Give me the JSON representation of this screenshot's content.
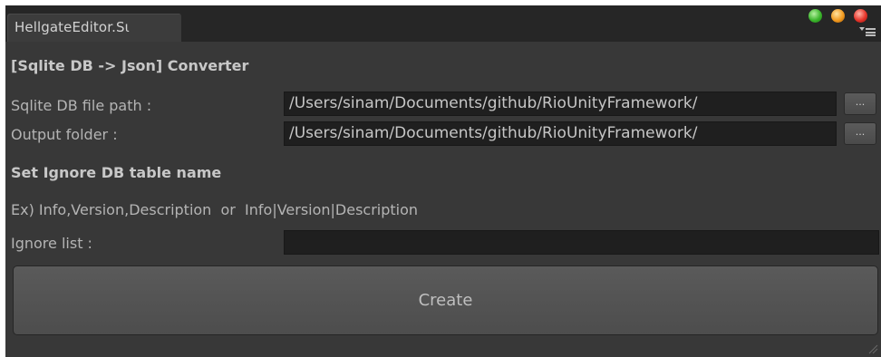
{
  "window": {
    "tab_title": "HellgateEditor.Sι",
    "colors": {
      "background": "#383838",
      "tabbar": "#262626",
      "field": "#1f1f1f",
      "close": "#e5342a",
      "minimize": "#f29a1f",
      "zoom": "#3cb52c"
    }
  },
  "converter": {
    "heading": "[Sqlite DB -> Json] Converter",
    "db_path_label": "Sqlite DB file path :",
    "db_path_value": "/Users/sinam/Documents/github/RioUnityFramework/",
    "db_path_browse": "...",
    "output_label": "Output folder :",
    "output_value": "/Users/sinam/Documents/github/RioUnityFramework/",
    "output_browse": "..."
  },
  "ignore": {
    "heading": "Set Ignore DB table name",
    "example": "Ex) Info,Version,Description  or  Info|Version|Description",
    "list_label": "Ignore list :",
    "list_value": ""
  },
  "actions": {
    "create_label": "Create"
  },
  "icons": [
    "zoom-button-icon",
    "minimize-button-icon",
    "close-button-icon",
    "tab-menu-icon",
    "resize-grip-icon"
  ]
}
